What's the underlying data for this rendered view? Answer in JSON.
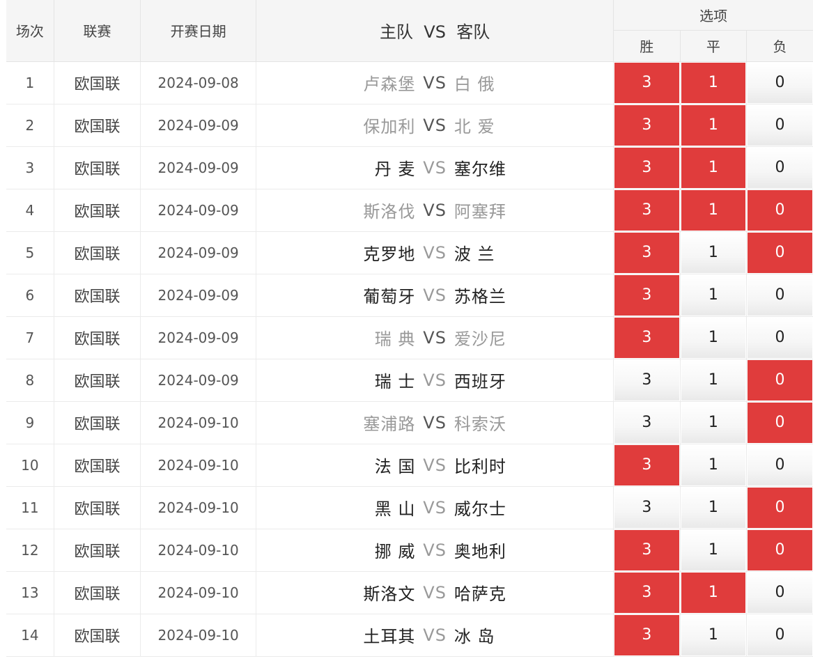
{
  "header": {
    "idx": "场次",
    "league": "联赛",
    "date": "开赛日期",
    "match": "主队  VS  客队",
    "options": "选项",
    "win": "胜",
    "draw": "平",
    "lose": "负"
  },
  "rows": [
    {
      "idx": "1",
      "league": "欧国联",
      "date": "2024-09-08",
      "home": "卢森堡",
      "vs": "VS",
      "away": "白 俄",
      "dim": true,
      "win": "3",
      "draw": "1",
      "lose": "0",
      "sel": [
        true,
        true,
        false
      ]
    },
    {
      "idx": "2",
      "league": "欧国联",
      "date": "2024-09-09",
      "home": "保加利",
      "vs": "VS",
      "away": "北 爱",
      "dim": true,
      "win": "3",
      "draw": "1",
      "lose": "0",
      "sel": [
        true,
        true,
        false
      ]
    },
    {
      "idx": "3",
      "league": "欧国联",
      "date": "2024-09-09",
      "home": "丹 麦",
      "vs": "VS",
      "away": "塞尔维",
      "dim": false,
      "win": "3",
      "draw": "1",
      "lose": "0",
      "sel": [
        true,
        true,
        false
      ]
    },
    {
      "idx": "4",
      "league": "欧国联",
      "date": "2024-09-09",
      "home": "斯洛伐",
      "vs": "VS",
      "away": "阿塞拜",
      "dim": true,
      "win": "3",
      "draw": "1",
      "lose": "0",
      "sel": [
        true,
        true,
        true
      ]
    },
    {
      "idx": "5",
      "league": "欧国联",
      "date": "2024-09-09",
      "home": "克罗地",
      "vs": "VS",
      "away": "波 兰",
      "dim": false,
      "win": "3",
      "draw": "1",
      "lose": "0",
      "sel": [
        true,
        false,
        true
      ]
    },
    {
      "idx": "6",
      "league": "欧国联",
      "date": "2024-09-09",
      "home": "葡萄牙",
      "vs": "VS",
      "away": "苏格兰",
      "dim": false,
      "win": "3",
      "draw": "1",
      "lose": "0",
      "sel": [
        true,
        false,
        false
      ]
    },
    {
      "idx": "7",
      "league": "欧国联",
      "date": "2024-09-09",
      "home": "瑞 典",
      "vs": "VS",
      "away": "爱沙尼",
      "dim": true,
      "win": "3",
      "draw": "1",
      "lose": "0",
      "sel": [
        true,
        false,
        false
      ]
    },
    {
      "idx": "8",
      "league": "欧国联",
      "date": "2024-09-09",
      "home": "瑞 士",
      "vs": "VS",
      "away": "西班牙",
      "dim": false,
      "win": "3",
      "draw": "1",
      "lose": "0",
      "sel": [
        false,
        false,
        true
      ]
    },
    {
      "idx": "9",
      "league": "欧国联",
      "date": "2024-09-10",
      "home": "塞浦路",
      "vs": "VS",
      "away": "科索沃",
      "dim": true,
      "win": "3",
      "draw": "1",
      "lose": "0",
      "sel": [
        false,
        false,
        true
      ]
    },
    {
      "idx": "10",
      "league": "欧国联",
      "date": "2024-09-10",
      "home": "法 国",
      "vs": "VS",
      "away": "比利时",
      "dim": false,
      "win": "3",
      "draw": "1",
      "lose": "0",
      "sel": [
        true,
        false,
        false
      ]
    },
    {
      "idx": "11",
      "league": "欧国联",
      "date": "2024-09-10",
      "home": "黑 山",
      "vs": "VS",
      "away": "威尔士",
      "dim": false,
      "win": "3",
      "draw": "1",
      "lose": "0",
      "sel": [
        false,
        false,
        true
      ]
    },
    {
      "idx": "12",
      "league": "欧国联",
      "date": "2024-09-10",
      "home": "挪 威",
      "vs": "VS",
      "away": "奥地利",
      "dim": false,
      "win": "3",
      "draw": "1",
      "lose": "0",
      "sel": [
        true,
        false,
        true
      ]
    },
    {
      "idx": "13",
      "league": "欧国联",
      "date": "2024-09-10",
      "home": "斯洛文",
      "vs": "VS",
      "away": "哈萨克",
      "dim": false,
      "win": "3",
      "draw": "1",
      "lose": "0",
      "sel": [
        true,
        true,
        false
      ]
    },
    {
      "idx": "14",
      "league": "欧国联",
      "date": "2024-09-10",
      "home": "土耳其",
      "vs": "VS",
      "away": "冰 岛",
      "dim": false,
      "win": "3",
      "draw": "1",
      "lose": "0",
      "sel": [
        true,
        false,
        false
      ]
    }
  ],
  "colors": {
    "selected": "#e03c3c",
    "header_bg": "#f5f5f5",
    "dim_team": "#999999"
  }
}
